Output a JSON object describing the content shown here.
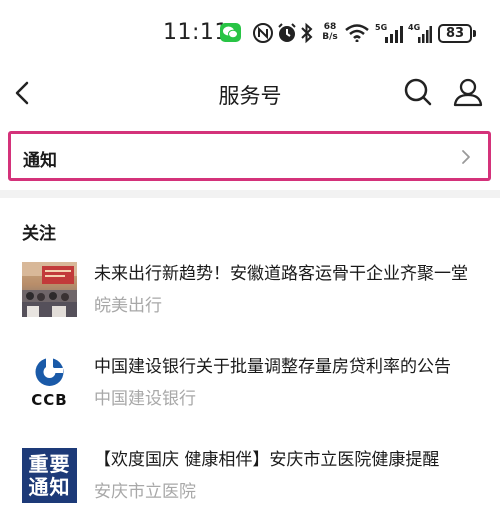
{
  "status_bar": {
    "time": "11:11",
    "speed_value": "68",
    "speed_unit": "B/s",
    "net1": "5G",
    "net2": "4G",
    "battery": "83"
  },
  "nav": {
    "title": "服务号"
  },
  "notice": {
    "label": "通知"
  },
  "section": {
    "title": "关注"
  },
  "feed": [
    {
      "title": "未来出行新趋势！安徽道路客运骨干企业齐聚一堂",
      "source": "皖美出行"
    },
    {
      "title": "中国建设银行关于批量调整存量房贷利率的公告",
      "source": "中国建设银行",
      "logo_text": "CCB"
    },
    {
      "title": "【欢度国庆 健康相伴】安庆市立医院健康提醒",
      "source": "安庆市立医院",
      "logo_lines": [
        "重要",
        "通知"
      ]
    }
  ],
  "colors": {
    "highlight_border": "#d4327a",
    "wechat_green": "#28c445",
    "ccb_blue": "#1a5aa8",
    "notice_blue": "#1d3a78",
    "muted_text": "#a8a8a8"
  },
  "icons": [
    "wechat-icon",
    "nfc-icon",
    "alarm-icon",
    "bluetooth-icon",
    "wifi-icon",
    "signal-icon",
    "battery-icon",
    "back-icon",
    "search-icon",
    "user-icon",
    "chevron-right-icon"
  ]
}
